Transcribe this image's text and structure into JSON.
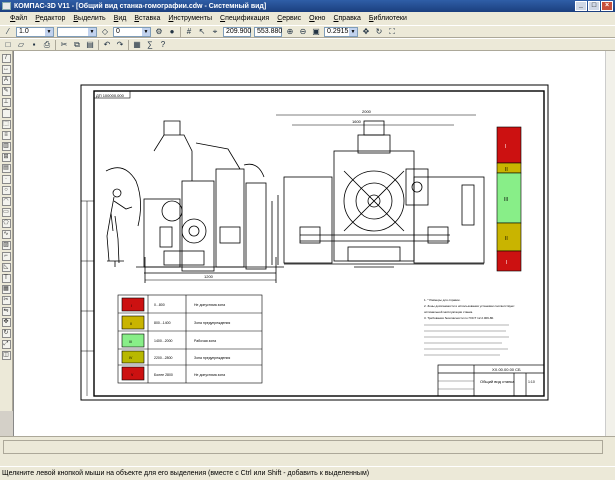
{
  "window": {
    "title": "КОМПАС-3D V11 - [Общий вид станка-гомографии.cdw - Системный вид]",
    "controls": [
      "_",
      "□",
      "×"
    ]
  },
  "menu": [
    "Файл",
    "Редактор",
    "Выделить",
    "Вид",
    "Вставка",
    "Инструменты",
    "Спецификация",
    "Сервис",
    "Окно",
    "Справка",
    "Библиотеки"
  ],
  "toolbar": {
    "scale_value": "1.0",
    "layer_value": "0",
    "coord_x": "209.900",
    "coord_y": "553.880",
    "zoom_value": "0.2915"
  },
  "drawing": {
    "stamp_code": "ДП 100000.000",
    "dim_bottom_left": "1200",
    "dim_top_right": "2000",
    "dim_top_right_inner": "1600",
    "legend": [
      {
        "mark": "I",
        "range": "0...800",
        "label": "Не допустима зона",
        "color": "#cc1111"
      },
      {
        "mark": "II",
        "range": "800...1400",
        "label": "Зона предупреждения",
        "color": "#c9b400"
      },
      {
        "mark": "III",
        "range": "1400...2000",
        "label": "Рабочая зона",
        "color": "#88ee88"
      },
      {
        "mark": "IV",
        "range": "2200...2800",
        "label": "Зона предупреждения",
        "color": "#b8b800"
      },
      {
        "mark": "V",
        "range": "Более 2800",
        "label": "Не допустима зона",
        "color": "#cc1111"
      }
    ],
    "notes": [
      "1. * Размеры для справок.",
      "2. Зоны досягаемости и использования установки соответствуют",
      "оптимальной эксплуатации станка.",
      "3. Требования безопасности по ГОСТ 12.2.009-80."
    ],
    "title_block": {
      "doc_number": "ХХ.00.00.00 СБ",
      "name": "Общий вид станка",
      "sheet": "1:10"
    },
    "side_zones": [
      "I",
      "II",
      "III",
      "II",
      "I"
    ],
    "side_zone_colors": [
      "#cc1111",
      "#c9b400",
      "#88ee88",
      "#c9b400",
      "#cc1111"
    ]
  },
  "status": {
    "message": "Щелкните левой кнопкой мыши на объекте для его выделения (вместе с Ctrl или Shift - добавить к выделенным)"
  }
}
